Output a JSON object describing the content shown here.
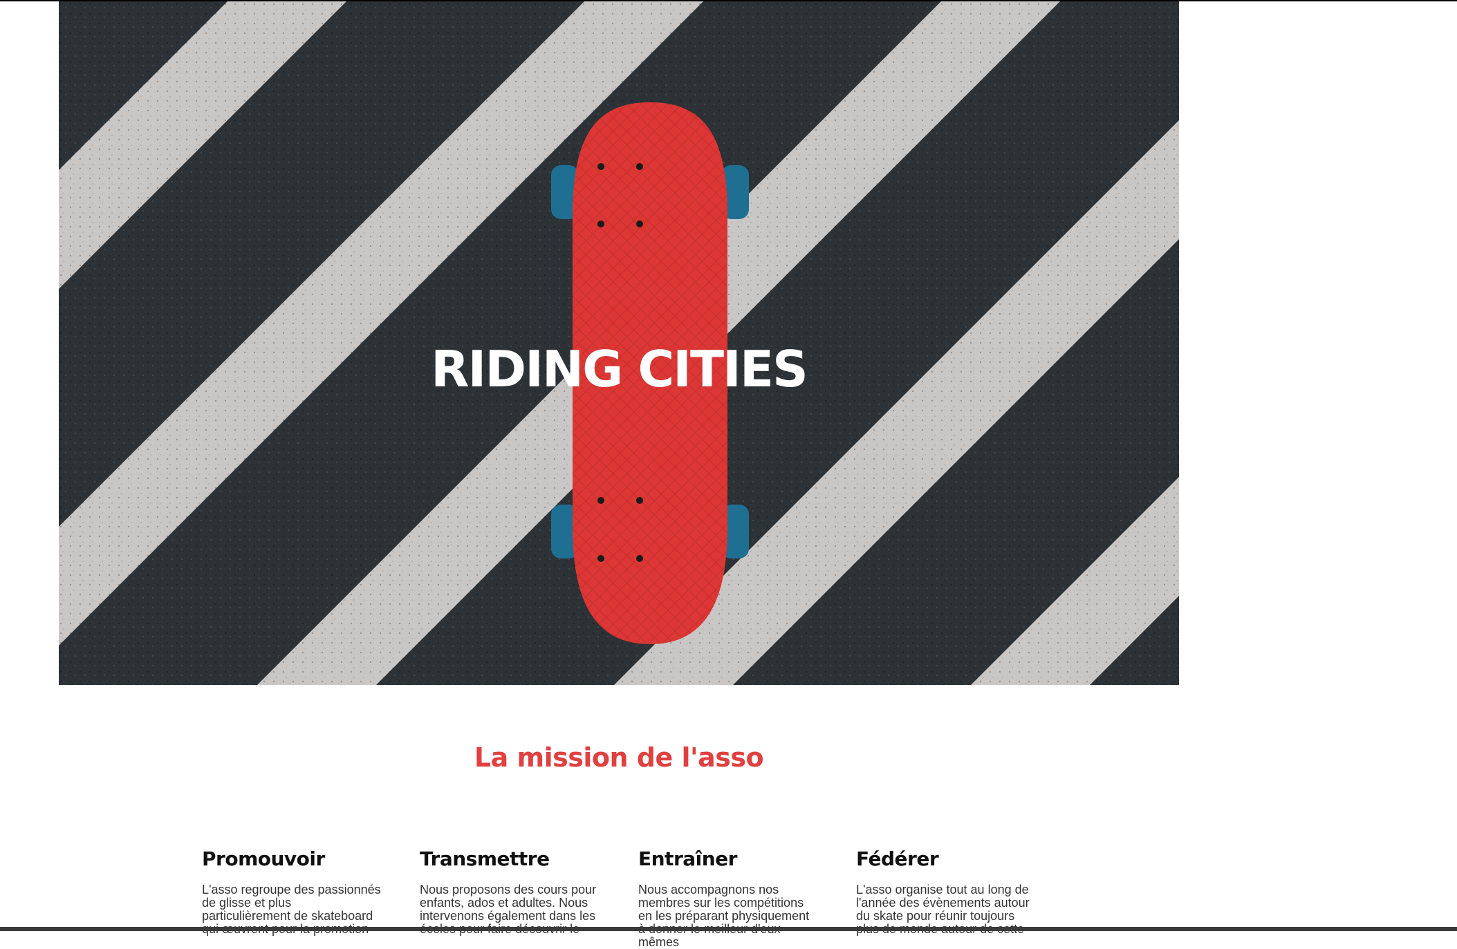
{
  "hero": {
    "title": "RIDING CITIES",
    "image_icon": "skateboard-on-crosswalk",
    "colors": {
      "asphalt": "#2c3236",
      "stripe": "#c9c7c6",
      "deck": "#dc3734",
      "wheels": "#1f6f93"
    }
  },
  "mission": {
    "title": "La mission de l'asso",
    "accent_color": "#e0403f",
    "pillars": [
      {
        "title": "Promouvoir",
        "text": "L'asso regroupe des passionnés de glisse et plus particulièrement de skateboard qui œuvrent pour la promotion"
      },
      {
        "title": "Transmettre",
        "text": "Nous proposons des cours pour enfants, ados et adultes. Nous intervenons également dans les écoles pour faire découvrir le"
      },
      {
        "title": "Entraîner",
        "text": "Nous accompagnons nos membres sur les compétitions en les préparant physiquement à donner le meilleur d'eux-mêmes"
      },
      {
        "title": "Fédérer",
        "text": "L'asso organise tout au long de l'année des évènements autour du skate pour réunir toujours plus de monde autour de cette"
      }
    ]
  }
}
